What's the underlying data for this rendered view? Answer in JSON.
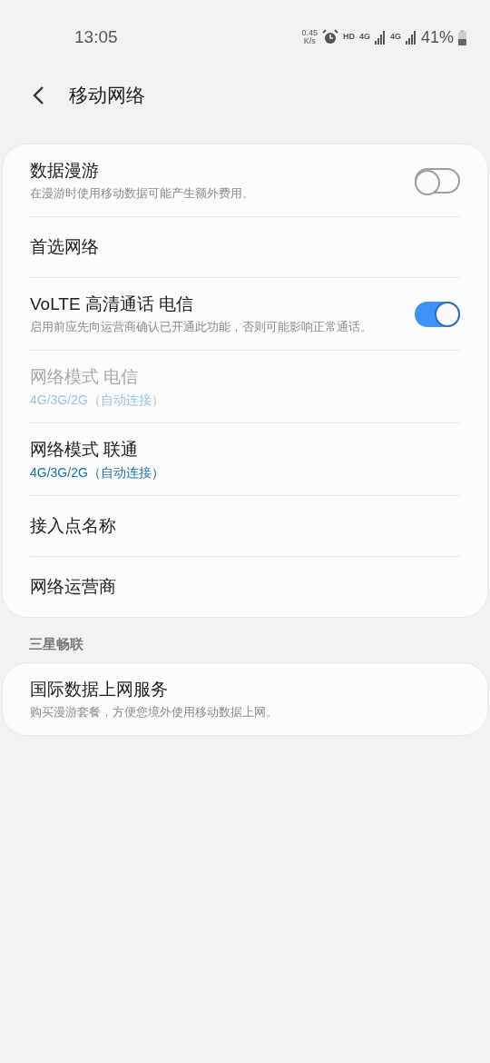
{
  "status_bar": {
    "time": "13:05",
    "speed_value": "0.45",
    "speed_unit": "K/s",
    "hd": "HD",
    "sim1": "4G",
    "sim2": "4G",
    "battery": "41%"
  },
  "header": {
    "title": "移动网络"
  },
  "sections": [
    {
      "items": [
        {
          "kind": "toggle",
          "title": "数据漫游",
          "summary": "在漫游时使用移动数据可能产生额外费用。",
          "on": false
        },
        {
          "kind": "plain",
          "title": "首选网络"
        },
        {
          "kind": "toggle",
          "title": "VoLTE 高清通话 电信",
          "summary": "启用前应先向运营商确认已开通此功能，否则可能影响正常通话。",
          "on": true
        },
        {
          "kind": "value",
          "title": "网络模式 电信",
          "value": "4G/3G/2G（自动连接）",
          "disabled": true
        },
        {
          "kind": "value",
          "title": "网络模式 联通",
          "value": "4G/3G/2G（自动连接）",
          "disabled": false
        },
        {
          "kind": "plain",
          "title": "接入点名称"
        },
        {
          "kind": "plain",
          "title": "网络运营商"
        }
      ]
    },
    {
      "header": "三星畅联",
      "items": [
        {
          "kind": "summary",
          "title": "国际数据上网服务",
          "summary": "购买漫游套餐，方便您境外使用移动数据上网。"
        }
      ]
    }
  ]
}
